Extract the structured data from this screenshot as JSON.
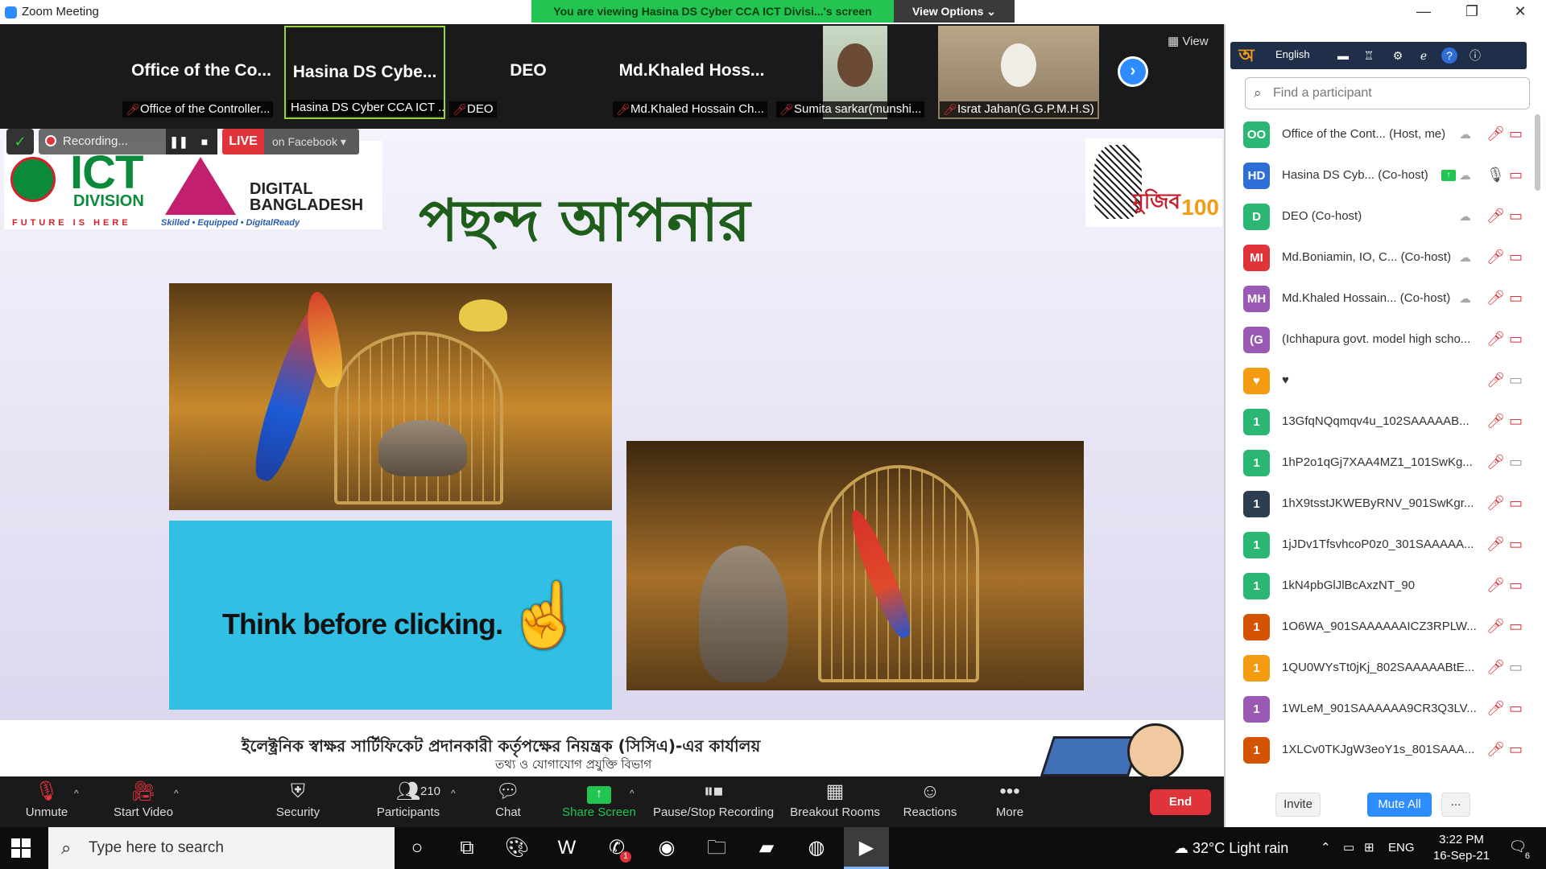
{
  "window": {
    "title": "Zoom Meeting",
    "banner": "You are viewing Hasina DS Cyber CCA ICT Divisi...'s screen",
    "view_options": "View Options",
    "minimize": "—",
    "restore": "❐",
    "close": "✕"
  },
  "gallery": {
    "tiles": [
      {
        "big": "Office of the Co...",
        "caption": "Office of the Controller..."
      },
      {
        "big": "Hasina DS Cybe...",
        "caption": "Hasina DS Cyber CCA ICT ..."
      },
      {
        "big": "DEO",
        "caption": "DEO"
      },
      {
        "big": "Md.Khaled Hoss...",
        "caption": "Md.Khaled Hossain Ch..."
      },
      {
        "big": "",
        "caption": "Sumita sarkar(munshi..."
      },
      {
        "big": "",
        "caption": "Israt Jahan(G.G.P.M.H.S)"
      }
    ],
    "view_label": "View",
    "next_icon": "chevron-right"
  },
  "recording": {
    "status": "Recording...",
    "pause": "❚❚",
    "stop": "■",
    "live": "LIVE",
    "platform": "on Facebook"
  },
  "slide": {
    "ict_word": "ICT",
    "ict_division": "DIVISION",
    "ict_tagline": "FUTURE IS HERE",
    "digital_bangladesh": "DIGITAL BANGLADESH",
    "db_sub": "Skilled • Equipped • DigitalReady",
    "heading": "পছন্দ আপনার",
    "mujib_tag": "মুজিব",
    "mujib_num": "100",
    "think": "Think before clicking.",
    "footer_line1": "ইলেক্ট্রনিক স্বাক্ষর সার্টিফিকেট প্রদানকারী কর্তৃপক্ষের নিয়ন্ত্রক (সিসিএ)-এর কার্যালয়",
    "footer_line2": "তথ্য ও যোগাযোগ প্রযুক্তি বিভাগ"
  },
  "toolbar": {
    "unmute": "Unmute",
    "start_video": "Start Video",
    "security": "Security",
    "participants": "Participants",
    "participants_count": "210",
    "chat": "Chat",
    "share_screen": "Share Screen",
    "pause_stop": "Pause/Stop Recording",
    "breakout": "Breakout Rooms",
    "reactions": "Reactions",
    "more": "More",
    "end": "End"
  },
  "panel": {
    "bijoy_lang": "English",
    "search_placeholder": "Find a participant",
    "participants": [
      {
        "initials": "OO",
        "color": "#2bb673",
        "name": "Office of the Cont...",
        "role": "(Host, me)",
        "mic": "muted",
        "video": "off"
      },
      {
        "initials": "HD",
        "color": "#2d6fd6",
        "name": "Hasina DS Cyb...",
        "role": "(Co-host)",
        "mic": "on",
        "video": "off",
        "sharing": true
      },
      {
        "initials": "D",
        "color": "#2bb673",
        "name": "DEO",
        "role": "(Co-host)",
        "mic": "muted",
        "video": "off"
      },
      {
        "initials": "MI",
        "color": "#e0333a",
        "name": "Md.Boniamin, IO, C...",
        "role": "(Co-host)",
        "mic": "muted",
        "video": "off"
      },
      {
        "initials": "MH",
        "color": "#9b59b6",
        "name": "Md.Khaled Hossain...",
        "role": "(Co-host)",
        "mic": "muted",
        "video": "off"
      },
      {
        "initials": "(G",
        "color": "#9b59b6",
        "name": "(Ichhapura govt. model high scho...",
        "role": "",
        "mic": "muted",
        "video": "off"
      },
      {
        "initials": "♥",
        "color": "#f39c12",
        "name": "♥",
        "role": "",
        "mic": "muted",
        "video": "on"
      },
      {
        "initials": "1",
        "color": "#2bb673",
        "name": "13GfqNQqmqv4u_102SAAAAAB...",
        "role": "",
        "mic": "muted",
        "video": "off"
      },
      {
        "initials": "1",
        "color": "#2bb673",
        "name": "1hP2o1qGj7XAA4MZ1_101SwKg...",
        "role": "",
        "mic": "muted",
        "video": "on"
      },
      {
        "initials": "1",
        "color": "#2c3e50",
        "name": "1hX9tsstJKWEByRNV_901SwKgr...",
        "role": "",
        "mic": "muted",
        "video": "off"
      },
      {
        "initials": "1",
        "color": "#2bb673",
        "name": "1jJDv1TfsvhcoP0z0_301SAAAAA...",
        "role": "",
        "mic": "muted",
        "video": "off"
      },
      {
        "initials": "1",
        "color": "#2bb673",
        "name": "1kN4pbGlJlBcAxzNT_90",
        "role": "",
        "mic": "muted",
        "video": "off"
      },
      {
        "initials": "1",
        "color": "#d35400",
        "name": "1O6WA_901SAAAAAAICZ3RPLW...",
        "role": "",
        "mic": "muted",
        "video": "off"
      },
      {
        "initials": "1",
        "color": "#f39c12",
        "name": "1QU0WYsTt0jKj_802SAAAAABtE...",
        "role": "",
        "mic": "muted",
        "video": "on"
      },
      {
        "initials": "1",
        "color": "#9b59b6",
        "name": "1WLeM_901SAAAAAA9CR3Q3LV...",
        "role": "",
        "mic": "muted",
        "video": "off"
      },
      {
        "initials": "1",
        "color": "#d35400",
        "name": "1XLCv0TKJgW3eoY1s_801SAAA...",
        "role": "",
        "mic": "muted",
        "video": "off"
      }
    ],
    "invite": "Invite",
    "mute_all": "Mute All",
    "more": "..."
  },
  "taskbar": {
    "search_placeholder": "Type here to search",
    "weather": "32°C  Light rain",
    "lang": "ENG",
    "time": "3:22 PM",
    "date": "16-Sep-21",
    "notif_count": "6",
    "whatsapp_badge": "1"
  }
}
